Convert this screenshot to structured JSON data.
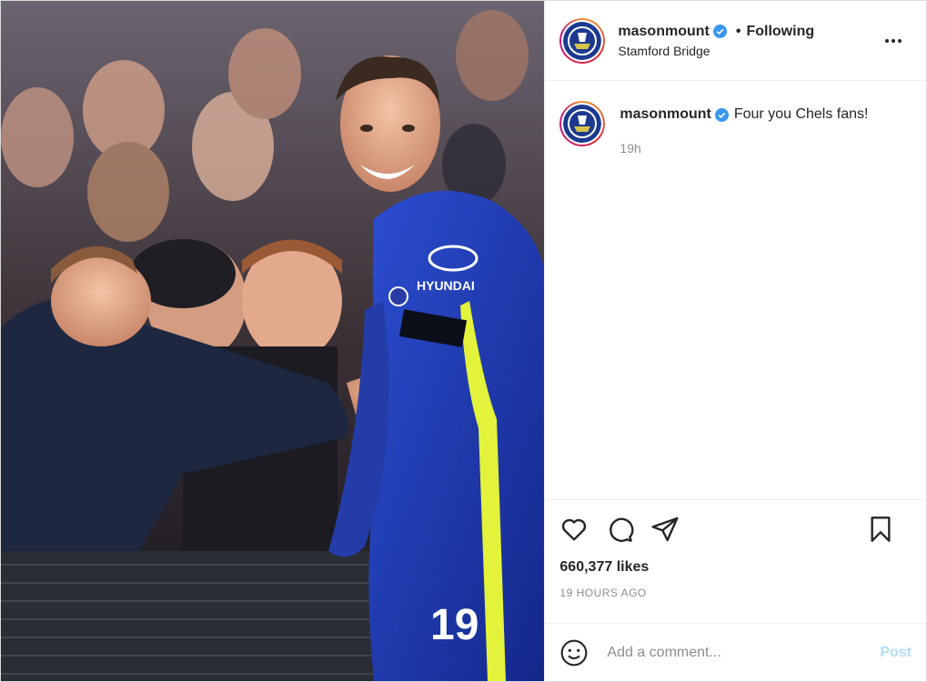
{
  "header": {
    "username": "masonmount",
    "separator": "•",
    "follow_status": "Following",
    "location": "Stamford Bridge",
    "more_icon": "more-horizontal-icon"
  },
  "caption": {
    "username": "masonmount",
    "text": "Four you Chels fans!",
    "time": "19h"
  },
  "photo": {
    "kit_text": "HYUNDAI",
    "shirt_number": "19"
  },
  "actions": {
    "icons": [
      "heart-icon",
      "comment-icon",
      "share-icon",
      "bookmark-icon"
    ],
    "likes": "660,377 likes",
    "posted_ago": "19 HOURS AGO"
  },
  "comment_box": {
    "placeholder": "Add a comment...",
    "post_label": "Post"
  },
  "colors": {
    "verified": "#3897f0",
    "post_disabled": "#b2dffc",
    "kit_blue": "#1e3fb8",
    "kit_yellow": "#e3f23a"
  }
}
